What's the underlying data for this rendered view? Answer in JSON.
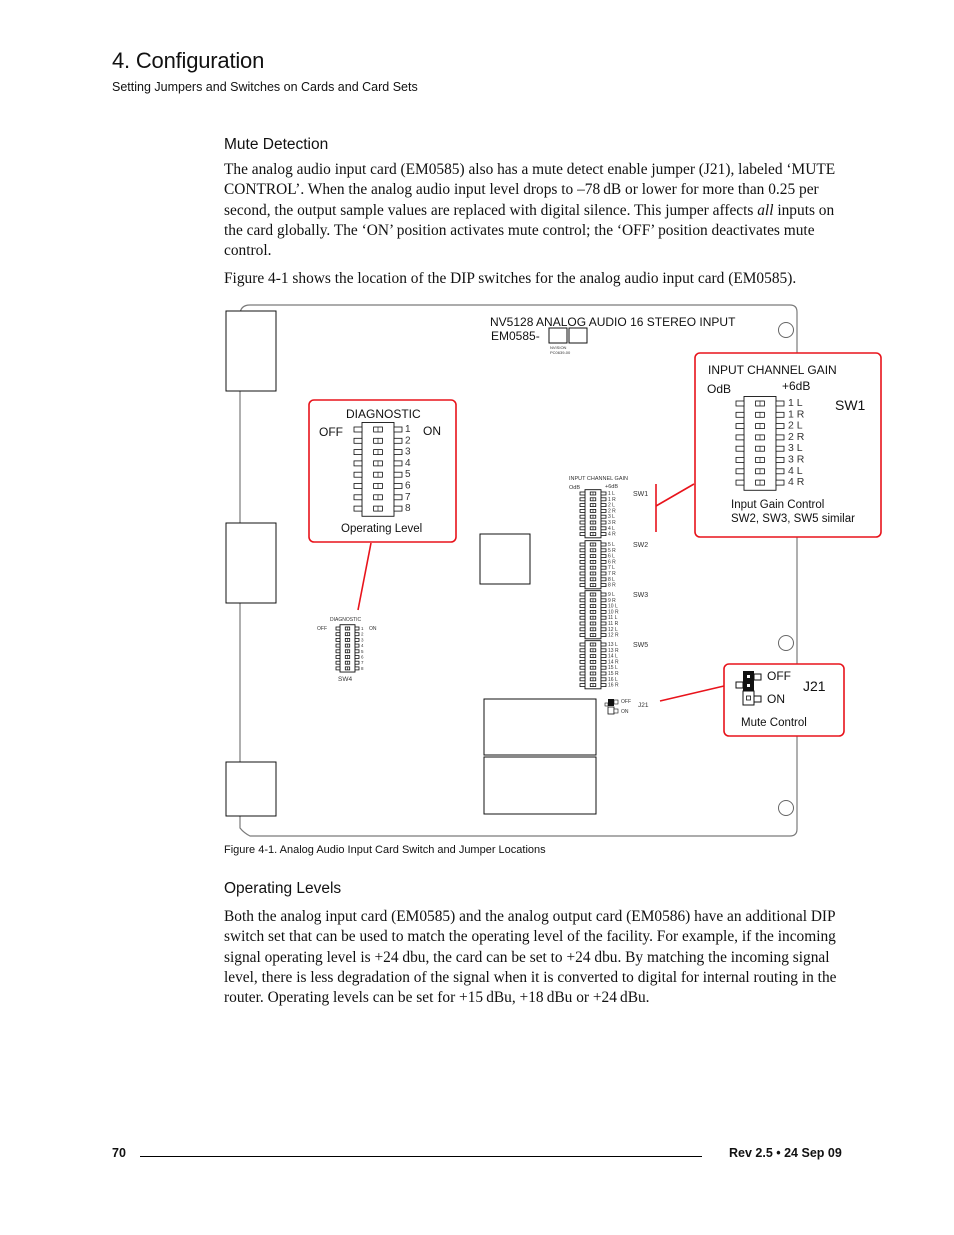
{
  "header": {
    "chapter_title": "4. Configuration",
    "section_subtitle": "Setting Jumpers and Switches on Cards and Card Sets"
  },
  "mute_detection": {
    "heading": "Mute Detection",
    "paragraph_1_part1": "The analog audio input card (EM0585) also has a mute detect enable jumper (J21), labeled ‘MUTE CONTROL’. When the analog audio input level drops to –78 dB or lower for more than 0.25 per second, the output sample values are replaced with digital silence. This jumper affects ",
    "paragraph_1_emph": "all",
    "paragraph_1_part2": " inputs on the card globally. The ‘ON’ position activates mute control; the ‘OFF’ position deactivates mute control.",
    "paragraph_2": "Figure 4-1 shows the location of the DIP switches for the analog audio input card (EM0585)."
  },
  "figure": {
    "caption": "Figure 4-1. Analog Audio Input Card Switch and Jumper Locations",
    "board": {
      "title": "NV5128 ANALOG AUDIO 16 STEREO INPUT",
      "part_number": "EM0585-",
      "silk_line1": "NVISION",
      "silk_line2": "PC0639-00",
      "gain_header": "INPUT CHANNEL GAIN",
      "gain_low": "OdB",
      "gain_high": "+6dB",
      "switches": [
        {
          "name": "SW1",
          "channels": [
            "1 L",
            "1 R",
            "2 L",
            "2 R",
            "3 L",
            "3 R",
            "4 L",
            "4 R"
          ]
        },
        {
          "name": "SW2",
          "channels": [
            "5 L",
            "5 R",
            "6 L",
            "6 R",
            "7 L",
            "7 R",
            "8 L",
            "8 R"
          ]
        },
        {
          "name": "SW3",
          "channels": [
            "9 L",
            "9 R",
            "10 L",
            "10 R",
            "11 L",
            "11 R",
            "12 L",
            "12 R"
          ]
        },
        {
          "name": "SW5",
          "channels": [
            "13 L",
            "13 R",
            "14 L",
            "14 R",
            "15 L",
            "15 R",
            "16 L",
            "16 R"
          ]
        }
      ],
      "diag_header": "DIAGNOSTIC",
      "diag_off": "OFF",
      "diag_on": "ON",
      "diag_positions": [
        "1",
        "2",
        "3",
        "4",
        "5",
        "6",
        "7",
        "8"
      ],
      "diag_switch_name": "SW4",
      "jumper_name": "J21",
      "jumper_off": "OFF",
      "jumper_on": "ON"
    },
    "callout_diagnostic": {
      "title": "DIAGNOSTIC",
      "off_label": "OFF",
      "on_label": "ON",
      "positions": [
        "1",
        "2",
        "3",
        "4",
        "5",
        "6",
        "7",
        "8"
      ],
      "footer": "Operating Level"
    },
    "callout_gain": {
      "title": "INPUT CHANNEL GAIN",
      "low_label": "OdB",
      "high_label": "+6dB",
      "switch_name": "SW1",
      "channels": [
        "1  L",
        "1  R",
        "2  L",
        "2  R",
        "3  L",
        "3  R",
        "4  L",
        "4  R"
      ],
      "footer_line1": "Input Gain Control",
      "footer_line2": "SW2, SW3, SW5 similar"
    },
    "callout_jumper": {
      "off_label": "OFF",
      "on_label": "ON",
      "jumper_name": "J21",
      "footer": "Mute Control"
    },
    "colors": {
      "callout": "#e8131b",
      "board_edge": "#7a7a7a"
    }
  },
  "operating_levels": {
    "heading": "Operating Levels",
    "paragraph": "Both the analog input card (EM0585) and the analog output card (EM0586) have an additional DIP switch set that can be used to match the operating level of the facility. For example, if the incoming signal operating level is +24 dbu, the card can be set to +24 dbu. By matching the incoming signal level, there is less degradation of the signal when it is converted to digital for internal routing in the router. Operating levels can be set for +15 dBu, +18 dBu or +24 dBu."
  },
  "footer": {
    "page_number": "70",
    "revision": "Rev 2.5 • 24 Sep 09"
  }
}
